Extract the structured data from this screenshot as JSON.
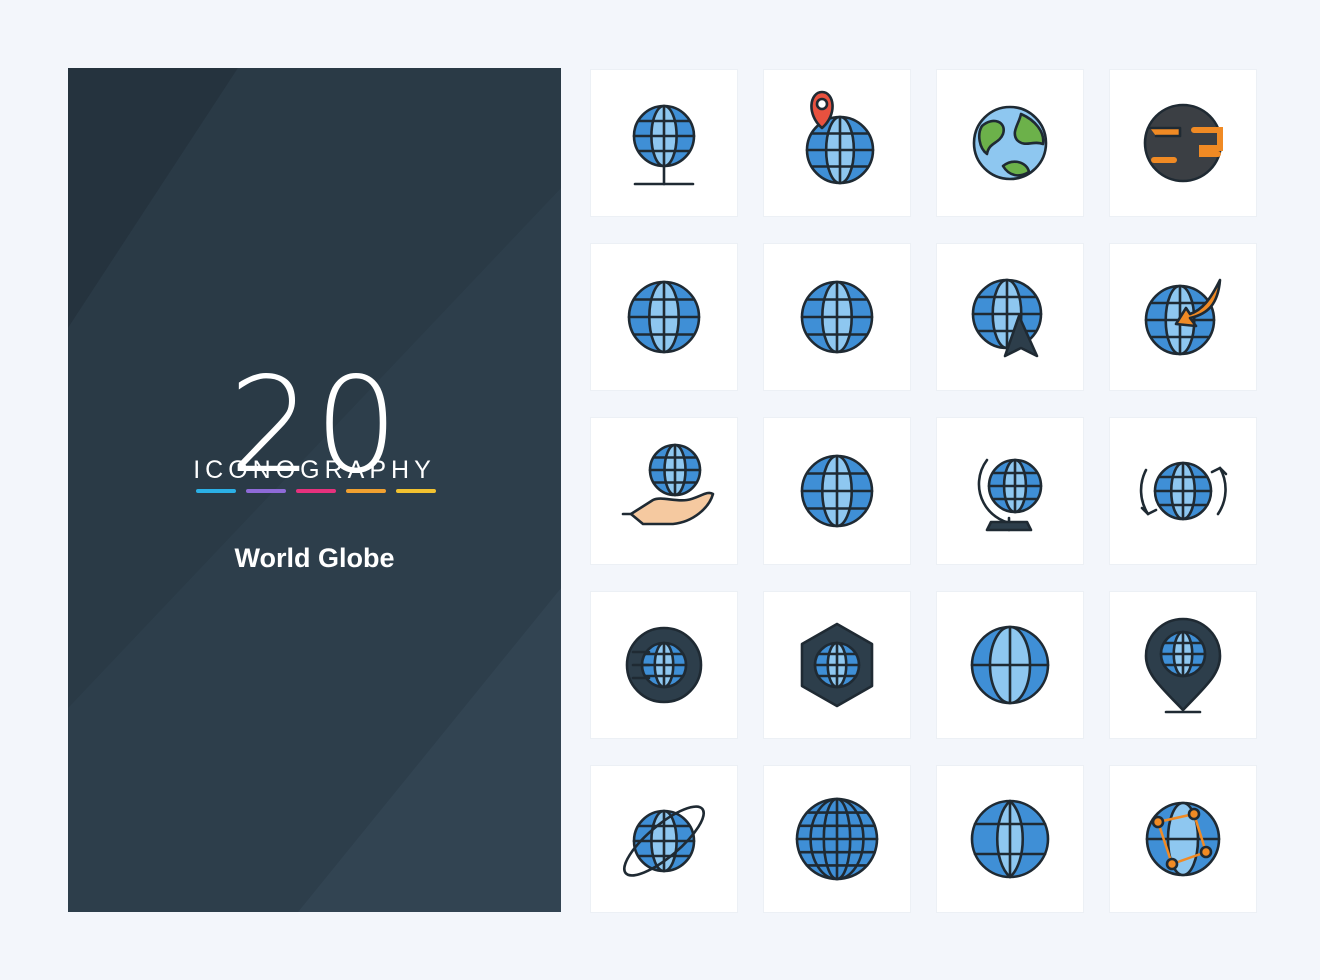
{
  "cover": {
    "number": "20",
    "brand": "ICONOGRAPHY",
    "title": "World Globe",
    "bar_colors": [
      "#2bb0e6",
      "#8e6ad8",
      "#e6317d",
      "#f0a030",
      "#f2c230"
    ]
  },
  "colors": {
    "background": "#f3f6fb",
    "cover": "#2d3e4b",
    "globe_fill": "#3f8fd6",
    "globe_light": "#8ec7f0",
    "stroke": "#1f2a33",
    "accent_orange": "#f08a24",
    "accent_red": "#e8513f",
    "land_green": "#6cb14a"
  },
  "icons": [
    "globe-on-stand-icon",
    "globe-location-pin-icon",
    "earth-continents-icon",
    "planet-icon",
    "grid-globe-icon",
    "grid-globe-icon",
    "globe-navigation-arrow-icon",
    "globe-arrow-icon",
    "globe-in-hand-icon",
    "grid-globe-icon",
    "desk-globe-icon",
    "rotate-globe-icon",
    "globe-circle-badge-icon",
    "globe-hexagon-badge-icon",
    "meridian-globe-icon",
    "globe-map-pin-icon",
    "globe-orbit-icon",
    "dense-grid-globe-icon",
    "simple-globe-icon",
    "network-globe-icon"
  ]
}
